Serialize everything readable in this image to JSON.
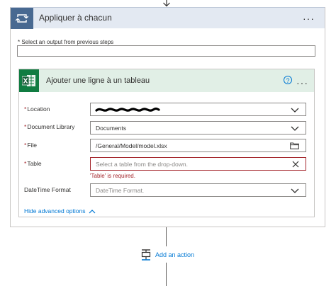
{
  "loop": {
    "title": "Appliquer à chacun",
    "menu_label": "···",
    "select_output_label": "* Select an output from previous steps",
    "select_output_value": ""
  },
  "action": {
    "title": "Ajouter une ligne à un tableau",
    "help_label": "?",
    "menu_label": "···",
    "fields": {
      "location": {
        "required": "*",
        "label": "Location",
        "value": ""
      },
      "library": {
        "required": "*",
        "label": "Document Library",
        "value": "Documents"
      },
      "file": {
        "required": "*",
        "label": "File",
        "value": "/General/Model/model.xlsx"
      },
      "table": {
        "required": "*",
        "label": "Table",
        "placeholder": "Select a table from the drop-down.",
        "error": "'Table' is required."
      },
      "datetime": {
        "label": "DateTime Format",
        "placeholder": "DateTime Format."
      }
    },
    "advanced_label": "Hide advanced options"
  },
  "add_action_label": "Add an action",
  "colors": {
    "loop_header": "#e3e9f2",
    "loop_tile": "#486991",
    "excel_header": "#e1efe6",
    "excel_tile": "#107c41",
    "link": "#0078d4",
    "error": "#a4262c"
  },
  "icons": {
    "loop": "loop-arrows-icon",
    "excel": "excel-icon",
    "help": "help-circle-icon",
    "dropdown": "chevron-down-icon",
    "file_picker": "folder-icon",
    "clear": "close-icon",
    "collapse": "chevron-up-icon",
    "add_action": "add-step-icon",
    "flow": "arrow-down-icon"
  }
}
